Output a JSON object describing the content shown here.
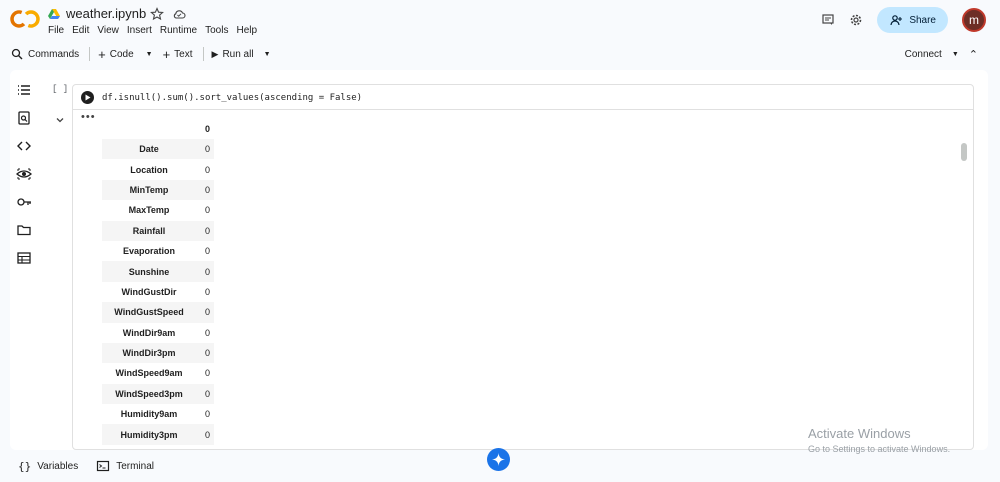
{
  "header": {
    "notebook_name": "weather.ipynb",
    "menu": [
      "File",
      "Edit",
      "View",
      "Insert",
      "Runtime",
      "Tools",
      "Help"
    ],
    "share_label": "Share",
    "avatar_letter": "m"
  },
  "toolbar": {
    "commands_label": "Commands",
    "code_label": "Code",
    "text_label": "Text",
    "run_all_label": "Run all",
    "connect_label": "Connect"
  },
  "cell": {
    "execution_count": "[ ]",
    "code": "df.isnull().sum().sort_values(ascending = False)",
    "output_dots": "•••",
    "output_column_header": "0",
    "rows": [
      {
        "index": "Date",
        "value": "0"
      },
      {
        "index": "Location",
        "value": "0"
      },
      {
        "index": "MinTemp",
        "value": "0"
      },
      {
        "index": "MaxTemp",
        "value": "0"
      },
      {
        "index": "Rainfall",
        "value": "0"
      },
      {
        "index": "Evaporation",
        "value": "0"
      },
      {
        "index": "Sunshine",
        "value": "0"
      },
      {
        "index": "WindGustDir",
        "value": "0"
      },
      {
        "index": "WindGustSpeed",
        "value": "0"
      },
      {
        "index": "WindDir9am",
        "value": "0"
      },
      {
        "index": "WindDir3pm",
        "value": "0"
      },
      {
        "index": "WindSpeed9am",
        "value": "0"
      },
      {
        "index": "WindSpeed3pm",
        "value": "0"
      },
      {
        "index": "Humidity9am",
        "value": "0"
      },
      {
        "index": "Humidity3pm",
        "value": "0"
      }
    ]
  },
  "statusbar": {
    "variables_label": "Variables",
    "terminal_label": "Terminal"
  },
  "watermark": {
    "line1": "Activate Windows",
    "line2": "Go to Settings to activate Windows."
  },
  "colors": {
    "accent": "#1a73e8",
    "share_bg": "#c2e7ff",
    "logo_orange": "#f9ab00",
    "logo_dark_orange": "#e37400"
  },
  "sidebar_icons": [
    "table-of-contents-icon",
    "find-replace-icon",
    "code-snippets-icon",
    "variables-inspector-icon",
    "secrets-key-icon",
    "files-folder-icon",
    "data-table-icon"
  ]
}
